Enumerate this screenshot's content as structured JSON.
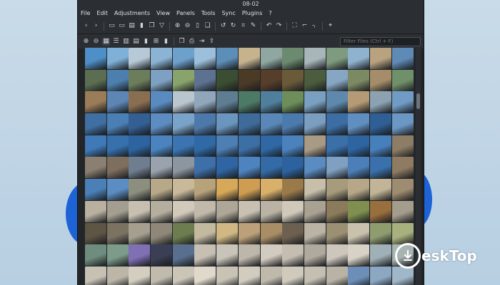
{
  "window": {
    "title": "08-02"
  },
  "menu": [
    "File",
    "Edit",
    "Adjustments",
    "View",
    "Panels",
    "Tools",
    "Sync",
    "Plugins",
    "?"
  ],
  "toolbar_icons": [
    {
      "name": "back-icon",
      "glyph": "‹"
    },
    {
      "name": "forward-icon",
      "glyph": "›"
    },
    {
      "sep": true
    },
    {
      "name": "folder-icon",
      "glyph": "▭"
    },
    {
      "name": "open-folder-icon",
      "glyph": "▭"
    },
    {
      "name": "gallery-icon",
      "glyph": "▤"
    },
    {
      "name": "trash-icon",
      "glyph": "▮"
    },
    {
      "name": "copy-icon",
      "glyph": "❐"
    },
    {
      "name": "filter-icon",
      "glyph": "▽"
    },
    {
      "sep": true
    },
    {
      "name": "zoom-in-icon",
      "glyph": "⊕"
    },
    {
      "name": "zoom-out-icon",
      "glyph": "⊖"
    },
    {
      "name": "document-icon",
      "glyph": "▯"
    },
    {
      "name": "document-copy-icon",
      "glyph": "❏"
    },
    {
      "sep": true
    },
    {
      "name": "rotate-left-icon",
      "glyph": "↺"
    },
    {
      "name": "rotate-right-icon",
      "glyph": "↻"
    },
    {
      "name": "crop-icon",
      "glyph": "⌗"
    },
    {
      "name": "edit-icon",
      "glyph": "✎"
    },
    {
      "sep": true
    },
    {
      "name": "undo-icon",
      "glyph": "↶"
    },
    {
      "name": "redo-icon",
      "glyph": "↷"
    },
    {
      "sep": true
    },
    {
      "name": "fullscreen-icon",
      "glyph": "⛶"
    },
    {
      "name": "fit-icon",
      "glyph": "⌐"
    },
    {
      "name": "bracket-icon",
      "glyph": "⌍"
    },
    {
      "sep": true
    },
    {
      "name": "location-icon",
      "glyph": "⌖"
    }
  ],
  "view_icons": [
    {
      "name": "zoom-in-icon",
      "glyph": "⊕"
    },
    {
      "name": "zoom-out-icon",
      "glyph": "⊖"
    },
    {
      "name": "grid-view-icon",
      "glyph": "▦",
      "active": true
    },
    {
      "name": "list-view-icon",
      "glyph": "☰"
    },
    {
      "name": "filmstrip-icon",
      "glyph": "▥"
    },
    {
      "name": "stack-icon",
      "glyph": "▤"
    },
    {
      "name": "detail-view-icon",
      "glyph": "▮"
    },
    {
      "name": "compare-icon",
      "glyph": "⊞"
    },
    {
      "name": "trash-icon",
      "glyph": "▮"
    },
    {
      "sep": true
    },
    {
      "name": "copy-icon",
      "glyph": "❐"
    },
    {
      "name": "print-icon",
      "glyph": "⎙"
    },
    {
      "name": "export-icon",
      "glyph": "⇥"
    },
    {
      "name": "share-icon",
      "glyph": "⇪"
    }
  ],
  "filter": {
    "placeholder": "Filter Files (Ctrl + F)",
    "value": ""
  },
  "thumbnails": [
    "#4e8fc7",
    "#7fb0d8",
    "#b7c9d6",
    "#8ab3d4",
    "#6ea0cc",
    "#9cc0dc",
    "#5d8eb8",
    "#c6b38e",
    "#8fa7a0",
    "#6c8a6f",
    "#a7b6b8",
    "#7e9b7f",
    "#8fb2cf",
    "#b8a280",
    "#5f8ab5",
    "#5b6e52",
    "#4d7fae",
    "#6b7d5a",
    "#7ea0c2",
    "#88a46c",
    "#5c7290",
    "#3b4d32",
    "#4a3a26",
    "#563e2a",
    "#6a5a3a",
    "#4b5d3e",
    "#87a6c4",
    "#7c8a64",
    "#a58d6a",
    "#70906a",
    "#9b7c58",
    "#5d86b5",
    "#8a6e52",
    "#5a8bc0",
    "#b9c6cf",
    "#8fa6bb",
    "#5f7d92",
    "#4d7a66",
    "#4f7f9c",
    "#6d8e5a",
    "#79a0c0",
    "#5e89ad",
    "#b59a76",
    "#8aa2b2",
    "#6f9bc4",
    "#3f6fa3",
    "#4a7fb6",
    "#335f92",
    "#5c8cc0",
    "#7aa3c9",
    "#4d79aa",
    "#6a95bf",
    "#3e6b9a",
    "#5988b8",
    "#4b7aad",
    "#7b9ec0",
    "#3c6ea4",
    "#5f8fc0",
    "#2f5f95",
    "#6b97c4",
    "#3f79b8",
    "#3670ad",
    "#2d649f",
    "#4a83bf",
    "#3b74b1",
    "#2f6aa7",
    "#4d7fb5",
    "#3c6fa6",
    "#2f68a5",
    "#4b82bd",
    "#a99a85",
    "#3a6fa8",
    "#2e64a0",
    "#4680bb",
    "#8e7d66",
    "#8a7f70",
    "#7d6e5e",
    "#6f7e8f",
    "#9aa3ad",
    "#8c96a0",
    "#3d6fa8",
    "#2f65a2",
    "#4d84c0",
    "#336ba7",
    "#2c639f",
    "#5a8cc2",
    "#7fa0c0",
    "#4c7fb8",
    "#3a70ab",
    "#8e7b62",
    "#4a7fb8",
    "#5b8cc2",
    "#8c8f7e",
    "#b7a987",
    "#c9b89a",
    "#b8a27a",
    "#d6a85a",
    "#cf9d52",
    "#d9b06a",
    "#9b7a4a",
    "#c7bfa9",
    "#a89a7c",
    "#b6a788",
    "#c2b496",
    "#9d8c70",
    "#b9b0a0",
    "#a49e90",
    "#c7c0b1",
    "#b5ae9f",
    "#d1cabb",
    "#c1baab",
    "#aea797",
    "#c8c1b2",
    "#bab3a4",
    "#d0c9ba",
    "#a9a292",
    "#8b7b5b",
    "#7e8f4f",
    "#9a6f3e",
    "#a49d8c",
    "#5e5545",
    "#7b7262",
    "#a69f8f",
    "#8f8878",
    "#6d7d4f",
    "#c2b99f",
    "#d0b784",
    "#bba07a",
    "#a88d66",
    "#6e6050",
    "#bbb4a5",
    "#9b8f74",
    "#c9c1ad",
    "#8f9c6e",
    "#a8b07d",
    "#6f8d7e",
    "#7c9b8a",
    "#7f6fb3",
    "#3a3f55",
    "#5a6f8f",
    "#c6bfb2",
    "#c9c4b9",
    "#bdb6ab",
    "#d2cbc0",
    "#c4bdb2",
    "#b0a99e",
    "#cdc6bb",
    "#d8d1c6",
    "#9fb0b6",
    "#a8b4b2",
    "#c7c1b4",
    "#bcb6a9",
    "#d4cec1",
    "#c1bbae",
    "#cbc5b8",
    "#e0d8cb",
    "#c9c3b6",
    "#d2ccbf",
    "#bfb9ac",
    "#d0cabd",
    "#c5bfb2",
    "#b9b3a6",
    "#6d8fb7",
    "#8ba7c1",
    "#9fb7c9"
  ]
}
